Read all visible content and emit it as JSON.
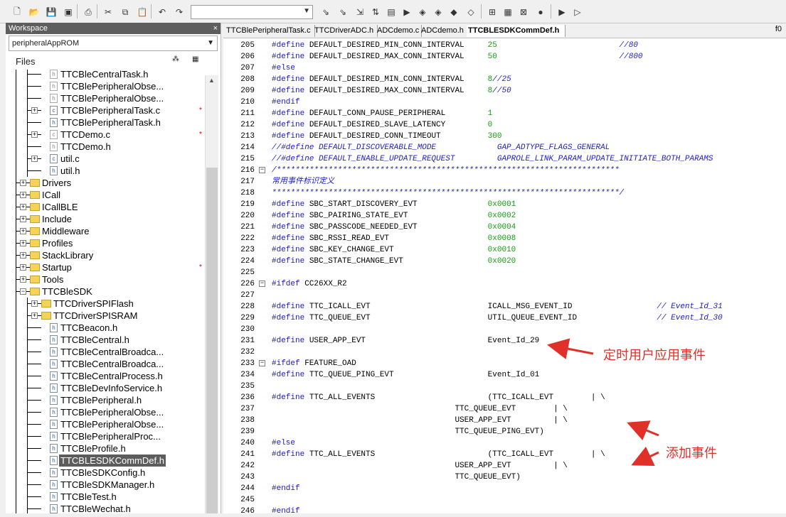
{
  "toolbar": {
    "combo_value": ""
  },
  "workspace": {
    "title": "Workspace",
    "close": "×",
    "project": "peripheralAppROM",
    "files_label": "Files",
    "tree": [
      {
        "label": "TTCBleCentralTask.h",
        "kind": "file",
        "dim": true,
        "expand": false,
        "star": false
      },
      {
        "label": "TTCBlePeripheralObse...",
        "kind": "file",
        "dim": true,
        "expand": false,
        "star": false
      },
      {
        "label": "TTCBlePeripheralObse...",
        "kind": "file",
        "dim": true,
        "expand": false,
        "star": false
      },
      {
        "label": "TTCBlePeripheralTask.c",
        "kind": "file",
        "dim": false,
        "expand": true,
        "star": true
      },
      {
        "label": "TTCBlePeripheralTask.h",
        "kind": "file",
        "dim": false,
        "expand": false,
        "star": false
      },
      {
        "label": "TTCDemo.c",
        "kind": "file",
        "dim": true,
        "expand": true,
        "star": true
      },
      {
        "label": "TTCDemo.h",
        "kind": "file",
        "dim": true,
        "expand": false,
        "star": false
      },
      {
        "label": "util.c",
        "kind": "file",
        "dim": false,
        "expand": true,
        "star": false
      },
      {
        "label": "util.h",
        "kind": "file",
        "dim": false,
        "expand": false,
        "star": false
      },
      {
        "label": "Drivers",
        "kind": "folder",
        "level": 0,
        "expand": true,
        "star": false
      },
      {
        "label": "ICall",
        "kind": "folder",
        "level": 0,
        "expand": true,
        "star": false
      },
      {
        "label": "ICallBLE",
        "kind": "folder",
        "level": 0,
        "expand": true,
        "star": false
      },
      {
        "label": "Include",
        "kind": "folder",
        "level": 0,
        "expand": true,
        "star": false
      },
      {
        "label": "Middleware",
        "kind": "folder",
        "level": 0,
        "expand": true,
        "star": false
      },
      {
        "label": "Profiles",
        "kind": "folder",
        "level": 0,
        "expand": true,
        "star": false
      },
      {
        "label": "StackLibrary",
        "kind": "folder",
        "level": 0,
        "expand": true,
        "star": false
      },
      {
        "label": "Startup",
        "kind": "folder",
        "level": 0,
        "expand": true,
        "star": true
      },
      {
        "label": "Tools",
        "kind": "folder",
        "level": 0,
        "expand": true,
        "star": false
      },
      {
        "label": "TTCBleSDK",
        "kind": "folder",
        "level": 0,
        "expand": "minus",
        "star": false
      },
      {
        "label": "TTCDriverSPIFlash",
        "kind": "folder",
        "level": 1,
        "expand": true,
        "star": false
      },
      {
        "label": "TTCDriverSPISRAM",
        "kind": "folder",
        "level": 1,
        "expand": true,
        "star": false
      },
      {
        "label": "TTCBeacon.h",
        "kind": "file",
        "dim": false,
        "expand": false,
        "star": false
      },
      {
        "label": "TTCBleCentral.h",
        "kind": "file",
        "dim": false,
        "expand": false,
        "star": false
      },
      {
        "label": "TTCBleCentralBroadca...",
        "kind": "file",
        "dim": false,
        "expand": false,
        "star": false
      },
      {
        "label": "TTCBleCentralBroadca...",
        "kind": "file",
        "dim": false,
        "expand": false,
        "star": false
      },
      {
        "label": "TTCBleCentralProcess.h",
        "kind": "file",
        "dim": false,
        "expand": false,
        "star": false
      },
      {
        "label": "TTCBleDevInfoService.h",
        "kind": "file",
        "dim": false,
        "expand": false,
        "star": false
      },
      {
        "label": "TTCBlePeripheral.h",
        "kind": "file",
        "dim": false,
        "expand": false,
        "star": false
      },
      {
        "label": "TTCBlePeripheralObse...",
        "kind": "file",
        "dim": false,
        "expand": false,
        "star": false
      },
      {
        "label": "TTCBlePeripheralObse...",
        "kind": "file",
        "dim": false,
        "expand": false,
        "star": false
      },
      {
        "label": "TTCBlePeripheralProc...",
        "kind": "file",
        "dim": false,
        "expand": false,
        "star": false
      },
      {
        "label": "TTCBleProfile.h",
        "kind": "file",
        "dim": false,
        "expand": false,
        "star": false
      },
      {
        "label": "TTCBLESDKCommDef.h",
        "kind": "file",
        "dim": false,
        "expand": false,
        "star": false,
        "selected": true
      },
      {
        "label": "TTCBleSDKConfig.h",
        "kind": "file",
        "dim": false,
        "expand": false,
        "star": false
      },
      {
        "label": "TTCBleSDKManager.h",
        "kind": "file",
        "dim": false,
        "expand": false,
        "star": false
      },
      {
        "label": "TTCBleTest.h",
        "kind": "file",
        "dim": false,
        "expand": false,
        "star": false
      },
      {
        "label": "TTCBleWechat.h",
        "kind": "file",
        "dim": false,
        "expand": false,
        "star": false
      }
    ]
  },
  "tabs": [
    {
      "label": "TTCBlePeripheralTask.c",
      "active": false
    },
    {
      "label": "TTCDriverADC.h",
      "active": false
    },
    {
      "label": "ADCdemo.c",
      "active": false
    },
    {
      "label": "ADCdemo.h",
      "active": false
    },
    {
      "label": "TTCBLESDKCommDef.h",
      "active": true
    }
  ],
  "tab_right": "f0",
  "code": [
    {
      "n": "205",
      "t": [
        [
          "kw",
          "#define"
        ],
        [
          "",
          " DEFAULT_DESIRED_MIN_CONN_INTERVAL     "
        ],
        [
          "num",
          "25"
        ],
        [
          "",
          "                          "
        ],
        [
          "cm",
          "//80"
        ]
      ]
    },
    {
      "n": "206",
      "t": [
        [
          "kw",
          "#define"
        ],
        [
          "",
          " DEFAULT_DESIRED_MAX_CONN_INTERVAL     "
        ],
        [
          "num",
          "50"
        ],
        [
          "",
          "                          "
        ],
        [
          "cm",
          "//800"
        ]
      ]
    },
    {
      "n": "207",
      "t": [
        [
          "kw",
          "#else"
        ]
      ]
    },
    {
      "n": "208",
      "t": [
        [
          "kw",
          "#define"
        ],
        [
          "",
          " DEFAULT_DESIRED_MIN_CONN_INTERVAL     "
        ],
        [
          "num",
          "8"
        ],
        [
          "cm",
          "//25"
        ]
      ]
    },
    {
      "n": "209",
      "t": [
        [
          "kw",
          "#define"
        ],
        [
          "",
          " DEFAULT_DESIRED_MAX_CONN_INTERVAL     "
        ],
        [
          "num",
          "8"
        ],
        [
          "cm",
          "//50"
        ]
      ]
    },
    {
      "n": "210",
      "t": [
        [
          "kw",
          "#endif"
        ]
      ]
    },
    {
      "n": "211",
      "t": [
        [
          "kw",
          "#define"
        ],
        [
          "",
          " DEFAULT_CONN_PAUSE_PERIPHERAL         "
        ],
        [
          "num",
          "1"
        ]
      ]
    },
    {
      "n": "212",
      "t": [
        [
          "kw",
          "#define"
        ],
        [
          "",
          " DEFAULT_DESIRED_SLAVE_LATENCY         "
        ],
        [
          "num",
          "0"
        ]
      ]
    },
    {
      "n": "213",
      "t": [
        [
          "kw",
          "#define"
        ],
        [
          "",
          " DEFAULT_DESIRED_CONN_TIMEOUT          "
        ],
        [
          "num",
          "300"
        ]
      ]
    },
    {
      "n": "214",
      "t": [
        [
          "cm",
          "//#define DEFAULT_DISCOVERABLE_MODE             GAP_ADTYPE_FLAGS_GENERAL"
        ]
      ]
    },
    {
      "n": "215",
      "t": [
        [
          "cm",
          "//#define DEFAULT_ENABLE_UPDATE_REQUEST         GAPROLE_LINK_PARAM_UPDATE_INITIATE_BOTH_PARAMS"
        ]
      ]
    },
    {
      "n": "216",
      "fold": "−",
      "t": [
        [
          "cm",
          "/*************************************************************************"
        ]
      ]
    },
    {
      "n": "217",
      "t": [
        [
          "cm",
          "常用事件标识定义"
        ]
      ]
    },
    {
      "n": "218",
      "t": [
        [
          "cm",
          "**************************************************************************/"
        ]
      ]
    },
    {
      "n": "219",
      "t": [
        [
          "kw",
          "#define"
        ],
        [
          "",
          " SBC_START_DISCOVERY_EVT               "
        ],
        [
          "num",
          "0x0001"
        ]
      ]
    },
    {
      "n": "220",
      "t": [
        [
          "kw",
          "#define"
        ],
        [
          "",
          " SBC_PAIRING_STATE_EVT                 "
        ],
        [
          "num",
          "0x0002"
        ]
      ]
    },
    {
      "n": "221",
      "t": [
        [
          "kw",
          "#define"
        ],
        [
          "",
          " SBC_PASSCODE_NEEDED_EVT               "
        ],
        [
          "num",
          "0x0004"
        ]
      ]
    },
    {
      "n": "222",
      "t": [
        [
          "kw",
          "#define"
        ],
        [
          "",
          " SBC_RSSI_READ_EVT                     "
        ],
        [
          "num",
          "0x0008"
        ]
      ]
    },
    {
      "n": "223",
      "t": [
        [
          "kw",
          "#define"
        ],
        [
          "",
          " SBC_KEY_CHANGE_EVT                    "
        ],
        [
          "num",
          "0x0010"
        ]
      ]
    },
    {
      "n": "224",
      "t": [
        [
          "kw",
          "#define"
        ],
        [
          "",
          " SBC_STATE_CHANGE_EVT                  "
        ],
        [
          "num",
          "0x0020"
        ]
      ]
    },
    {
      "n": "225",
      "t": []
    },
    {
      "n": "226",
      "fold": "−",
      "t": [
        [
          "kw",
          "#ifdef"
        ],
        [
          "",
          " CC26XX_R2"
        ]
      ]
    },
    {
      "n": "227",
      "t": []
    },
    {
      "n": "228",
      "t": [
        [
          "kw",
          "#define"
        ],
        [
          "",
          " TTC_ICALL_EVT                         ICALL_MSG_EVENT_ID                  "
        ],
        [
          "cm",
          "// Event_Id_31"
        ]
      ]
    },
    {
      "n": "229",
      "t": [
        [
          "kw",
          "#define"
        ],
        [
          "",
          " TTC_QUEUE_EVT                         UTIL_QUEUE_EVENT_ID                 "
        ],
        [
          "cm",
          "// Event_Id_30"
        ]
      ]
    },
    {
      "n": "230",
      "t": []
    },
    {
      "n": "231",
      "t": [
        [
          "kw",
          "#define"
        ],
        [
          "",
          " USER_APP_EVT                          Event_Id_29"
        ]
      ]
    },
    {
      "n": "232",
      "t": []
    },
    {
      "n": "233",
      "fold": "−",
      "t": [
        [
          "kw",
          "#ifdef"
        ],
        [
          "",
          " FEATURE_OAD"
        ]
      ]
    },
    {
      "n": "234",
      "t": [
        [
          "kw",
          "#define"
        ],
        [
          "",
          " TTC_QUEUE_PING_EVT                    Event_Id_01"
        ]
      ]
    },
    {
      "n": "235",
      "t": []
    },
    {
      "n": "236",
      "t": [
        [
          "kw",
          "#define"
        ],
        [
          "",
          " TTC_ALL_EVENTS                        (TTC_ICALL_EVT        | \\"
        ]
      ]
    },
    {
      "n": "237",
      "t": [
        [
          "",
          "                                       TTC_QUEUE_EVT        | \\"
        ]
      ]
    },
    {
      "n": "238",
      "t": [
        [
          "",
          "                                       USER_APP_EVT         | \\"
        ]
      ]
    },
    {
      "n": "239",
      "t": [
        [
          "",
          "                                       TTC_QUEUE_PING_EVT)"
        ]
      ]
    },
    {
      "n": "240",
      "t": [
        [
          "kw",
          "#else"
        ]
      ]
    },
    {
      "n": "241",
      "t": [
        [
          "kw",
          "#define"
        ],
        [
          "",
          " TTC_ALL_EVENTS                        (TTC_ICALL_EVT        | \\"
        ]
      ]
    },
    {
      "n": "242",
      "t": [
        [
          "",
          "                                       USER_APP_EVT         | \\"
        ]
      ]
    },
    {
      "n": "243",
      "t": [
        [
          "",
          "                                       TTC_QUEUE_EVT)"
        ]
      ]
    },
    {
      "n": "244",
      "t": [
        [
          "kw",
          "#endif"
        ]
      ]
    },
    {
      "n": "245",
      "t": []
    },
    {
      "n": "246",
      "t": [
        [
          "kw",
          "#endif"
        ]
      ]
    }
  ],
  "annotations": {
    "timer_event": "定时用户应用事件",
    "add_event": "添加事件"
  }
}
